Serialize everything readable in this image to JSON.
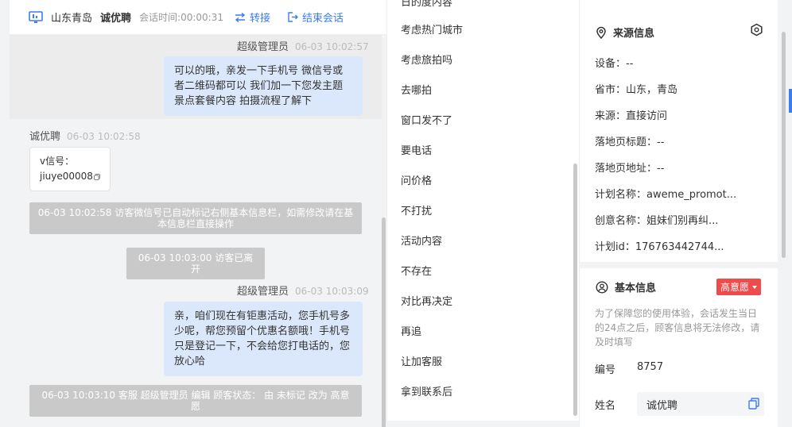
{
  "header": {
    "location": "山东青岛",
    "visitor_name": "诚优聘",
    "session_time_label": "会话时间:",
    "session_time": "00:00:31",
    "transfer_label": "转接",
    "end_label": "结束会话"
  },
  "chat": {
    "messages": [
      {
        "sender": "超级管理员",
        "time": "06-03 10:02:57",
        "text": "可以的哦，亲发一下手机号 微信号或者二维码都可以 我们加一下您发主题景点套餐内容 拍摄流程了解下"
      },
      {
        "sender": "诚优聘",
        "time": "06-03 10:02:58",
        "text_line1": "v信号：",
        "text_line2": "jiuye00008"
      },
      {
        "system": "06-03 10:02:58 访客微信号已自动标记右侧基本信息栏，如需修改请在基本信息栏直接操作"
      },
      {
        "system": "06-03 10:03:00 访客已离开"
      },
      {
        "sender": "超级管理员",
        "time": "06-03 10:03:09",
        "text": "亲，咱们现在有钜惠活动，您手机号多少呢，帮您预留个优惠名额哦！手机号只是登记一下，不会给您打电话的，您放心哈"
      },
      {
        "system": "06-03 10:03:10 客服 超级管理员 编辑 顾客状态： 由 未标记 改为 高意愿"
      }
    ]
  },
  "quick_replies": [
    "考虑热门城市",
    "考虑旅拍吗",
    "去哪拍",
    "窗口发不了",
    "要电话",
    "问价格",
    "不打扰",
    "活动内容",
    "不存在",
    "对比再决定",
    "再追",
    "让加客服",
    "拿到联系后"
  ],
  "source_info": {
    "title": "来源信息",
    "device": "设备：--",
    "region": "省市：山东，青岛",
    "source": "来源：直接访问",
    "landing_title": "落地页标题：--",
    "landing_url": "落地页地址：--",
    "plan_name": "计划名称：aweme_promot...",
    "creative_name": "创意名称：姐妹们别再纠...",
    "plan_id": "计划id：176763442744..."
  },
  "basic_info": {
    "title": "基本信息",
    "intent_badge": "高意愿",
    "notice": "为了保障您的使用体验，会话发生当日的24点之后，顾客信息将无法修改，请及时填写",
    "id_label": "编号",
    "id_value": "8757",
    "name_label": "姓名",
    "name_value": "诚优聘"
  },
  "colors": {
    "accent": "#3b7cf0",
    "bubble": "#dbe8fb",
    "badge": "#f04b4b"
  }
}
